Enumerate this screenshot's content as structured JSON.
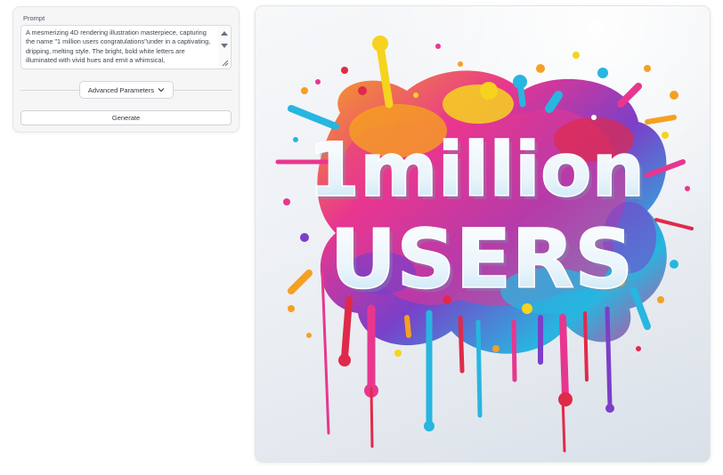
{
  "form": {
    "prompt_label": "Prompt",
    "prompt_value": "A mesmerizing 4D rendering illustration masterpiece, capturing the name \"1 million users congratulations\"under in a captivating, dripping, melting style. The bright, bold white letters are illuminated with vivid hues and emit a whimsical,",
    "advanced_label": "Advanced Parameters",
    "generate_label": "Generate"
  },
  "image": {
    "line1": "1million",
    "line2": "USERS"
  },
  "icons": {
    "advanced": "chevron-down-icon",
    "scroll_up": "scroll-up-arrow-icon",
    "scroll_down": "scroll-down-arrow-icon",
    "resize": "resize-handle-icon"
  },
  "colors": {
    "pink": "#e8368f",
    "orange": "#f5a020",
    "yellow": "#f6d31e",
    "cyan": "#27b6e0",
    "purple": "#7b3fc8",
    "red": "#e02a4a"
  }
}
